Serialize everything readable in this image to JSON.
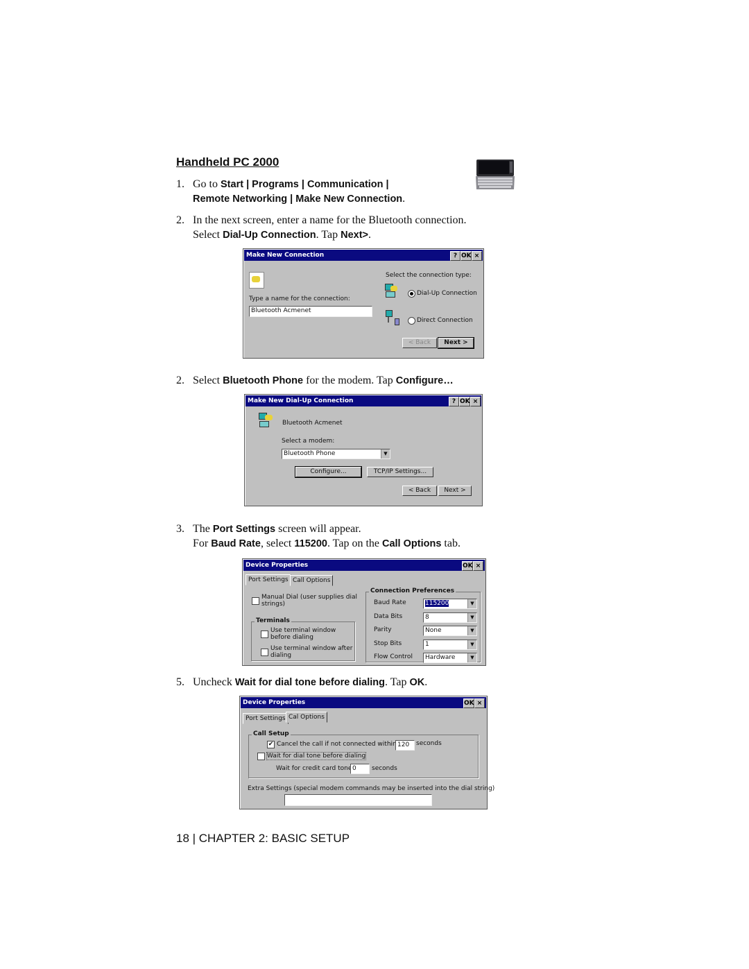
{
  "heading": "Handheld PC 2000",
  "device_image": "handheld-pc-icon",
  "steps": [
    {
      "num": "1.",
      "line1_prefix": "Go to ",
      "line1_bold": "Start | Programs | Communication |",
      "line2_bold": "Remote Networking | Make New Connection",
      "line2_suffix": "."
    },
    {
      "num": "2.",
      "line1": "In the next screen, enter a name for the Bluetooth connection.",
      "line2_prefix": "Select ",
      "line2_bold1": "Dial-Up Connection",
      "line2_mid": ". Tap ",
      "line2_bold2": "Next>",
      "line2_suffix": "."
    },
    {
      "num": "2.",
      "prefix": "Select ",
      "bold1": "Bluetooth Phone",
      "mid": " for the modem. Tap ",
      "bold2": "Configure…"
    },
    {
      "num": "3.",
      "line1_prefix": "The ",
      "line1_bold": "Port Settings",
      "line1_suffix": " screen will appear.",
      "line2_prefix": "For ",
      "line2_bold1": "Baud Rate",
      "line2_mid1": ", select ",
      "line2_bold2": "115200",
      "line2_mid2": ". Tap on the ",
      "line2_bold3": "Call Options",
      "line2_suffix": " tab."
    },
    {
      "num": "5.",
      "prefix": "Uncheck ",
      "bold1": "Wait for dial tone before dialing",
      "mid": ". Tap ",
      "bold2": "OK",
      "suffix": "."
    }
  ],
  "dialog1": {
    "title": "Make New Connection",
    "help": "?",
    "ok": "OK",
    "close": "×",
    "name_label": "Type a name for the connection:",
    "name_value": "Bluetooth Acmenet",
    "type_label": "Select the connection type:",
    "options": [
      {
        "label": "Dial-Up Connection",
        "selected": true
      },
      {
        "label": "Direct Connection",
        "selected": false
      }
    ],
    "back": "< Back",
    "next": "Next >"
  },
  "dialog2": {
    "title": "Make New Dial-Up Connection",
    "help": "?",
    "ok": "OK",
    "close": "×",
    "connection_name": "Bluetooth Acmenet",
    "modem_label": "Select a modem:",
    "modem_value": "Bluetooth Phone",
    "configure": "Configure...",
    "tcpip": "TCP/IP Settings...",
    "back": "< Back",
    "next": "Next >"
  },
  "dialog3": {
    "title": "Device Properties",
    "ok": "OK",
    "close": "×",
    "tabs": [
      "Port Settings",
      "Call Options"
    ],
    "manual_dial": "Manual Dial (user supplies dial strings)",
    "manual_dial_line1": "Manual Dial (user supplies dial",
    "manual_dial_line2": "strings)",
    "terminals_group": "Terminals",
    "term_before_1": "Use terminal window",
    "term_before_2": "before dialing",
    "term_after_1": "Use terminal window after",
    "term_after_2": "dialing",
    "prefs_group": "Connection Preferences",
    "settings": [
      {
        "label": "Baud Rate",
        "value": "115200",
        "highlighted": true
      },
      {
        "label": "Data Bits",
        "value": "8"
      },
      {
        "label": "Parity",
        "value": "None"
      },
      {
        "label": "Stop Bits",
        "value": "1"
      },
      {
        "label": "Flow Control",
        "value": "Hardware"
      }
    ]
  },
  "dialog4": {
    "title": "Device Properties",
    "ok": "OK",
    "close": "×",
    "tabs": [
      "Port Settings",
      "Cal Options"
    ],
    "call_setup_group": "Call Setup",
    "cancel_label": "Cancel the call if not connected within",
    "cancel_checked": true,
    "cancel_seconds": "120",
    "seconds": "seconds",
    "wait_label": "Wait for dial tone before dialing",
    "wait_checked": false,
    "credit_label": "Wait for credit card tone",
    "credit_value": "0",
    "extra_label": "Extra Settings (special modem commands may be inserted into the dial string)",
    "extra_value": ""
  },
  "footer": "18 | CHAPTER 2: BASIC SETUP"
}
